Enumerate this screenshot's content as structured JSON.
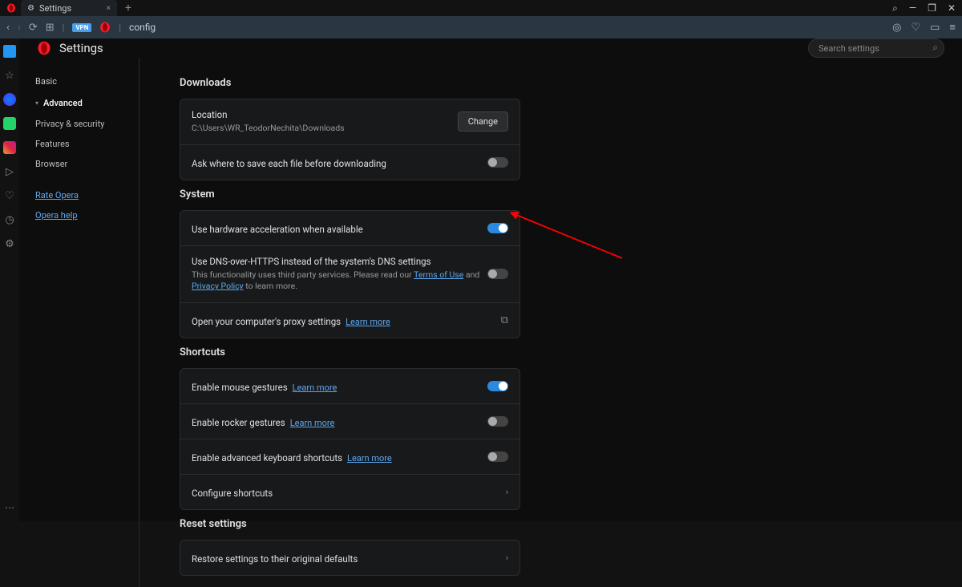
{
  "titlebar": {
    "tab_title": "Settings",
    "newtab": "+"
  },
  "addrbar": {
    "vpn": "VPN",
    "separator": "|",
    "text": "config"
  },
  "settings": {
    "title": "Settings",
    "search_placeholder": "Search settings",
    "nav": {
      "basic": "Basic",
      "advanced": "Advanced",
      "privacy": "Privacy & security",
      "features": "Features",
      "browser": "Browser",
      "rate": "Rate Opera",
      "help": "Opera help"
    },
    "downloads": {
      "title": "Downloads",
      "location_label": "Location",
      "location_value": "C:\\Users\\WR_TeodorNechita\\Downloads",
      "change_btn": "Change",
      "ask_save": "Ask where to save each file before downloading"
    },
    "system": {
      "title": "System",
      "hw_accel": "Use hardware acceleration when available",
      "dns_https": "Use DNS-over-HTTPS instead of the system's DNS settings",
      "dns_desc_1": "This functionality uses third party services. Please read our ",
      "terms": "Terms of Use",
      "and": " and ",
      "privacy": "Privacy Policy",
      "dns_desc_2": " to learn more.",
      "proxy": "Open your computer's proxy settings",
      "proxy_learn": "Learn more"
    },
    "shortcuts": {
      "title": "Shortcuts",
      "mouse_gestures": "Enable mouse gestures",
      "rocker": "Enable rocker gestures",
      "adv_kb": "Enable advanced keyboard shortcuts",
      "learn_more": "Learn more",
      "configure": "Configure shortcuts"
    },
    "reset": {
      "title": "Reset settings",
      "restore": "Restore settings to their original defaults"
    }
  }
}
